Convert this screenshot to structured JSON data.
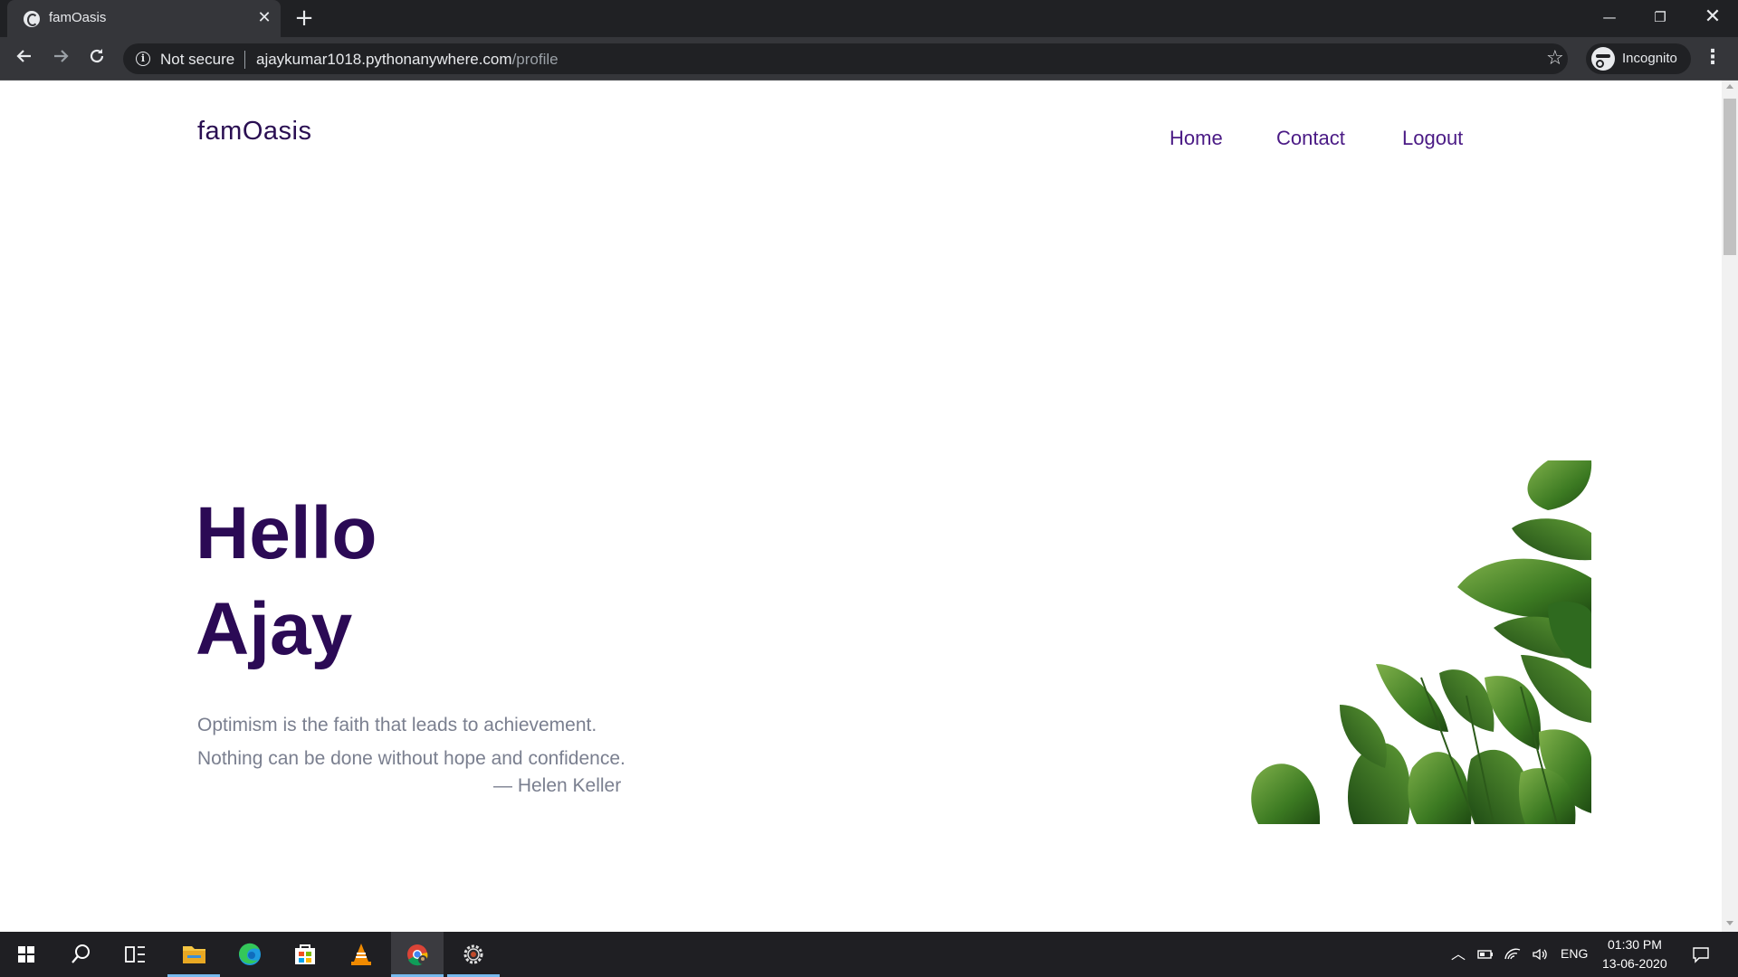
{
  "browser": {
    "tab_title": "famOasis",
    "tab_close": "✕",
    "new_tab": "+",
    "security_label": "Not secure",
    "url_domain": "ajaykumar1018.pythonanywhere.com",
    "url_path": "/profile",
    "profile_label": "Incognito",
    "window_controls": {
      "minimize": "—",
      "maximize": "❐",
      "close": "✕"
    }
  },
  "site": {
    "brand": "famOasis",
    "nav": [
      {
        "label": "Home"
      },
      {
        "label": "Contact"
      },
      {
        "label": "Logout"
      }
    ],
    "greeting_line1": "Hello",
    "greeting_line2": "Ajay",
    "quote_line1": "Optimism is the faith that leads to achievement.",
    "quote_line2": "Nothing can be done without hope and confidence.",
    "quote_author": "— Helen Keller",
    "colors": {
      "heading": "#2b0a55",
      "nav": "#4a1a85",
      "quote": "#7a7f8f"
    }
  },
  "taskbar": {
    "language": "ENG",
    "time": "01:30 PM",
    "date": "13-06-2020",
    "apps": [
      "start-icon",
      "search-icon",
      "task-view-icon",
      "file-explorer-icon",
      "edge-icon",
      "store-icon",
      "vlc-icon",
      "chrome-icon",
      "settings-icon"
    ]
  }
}
